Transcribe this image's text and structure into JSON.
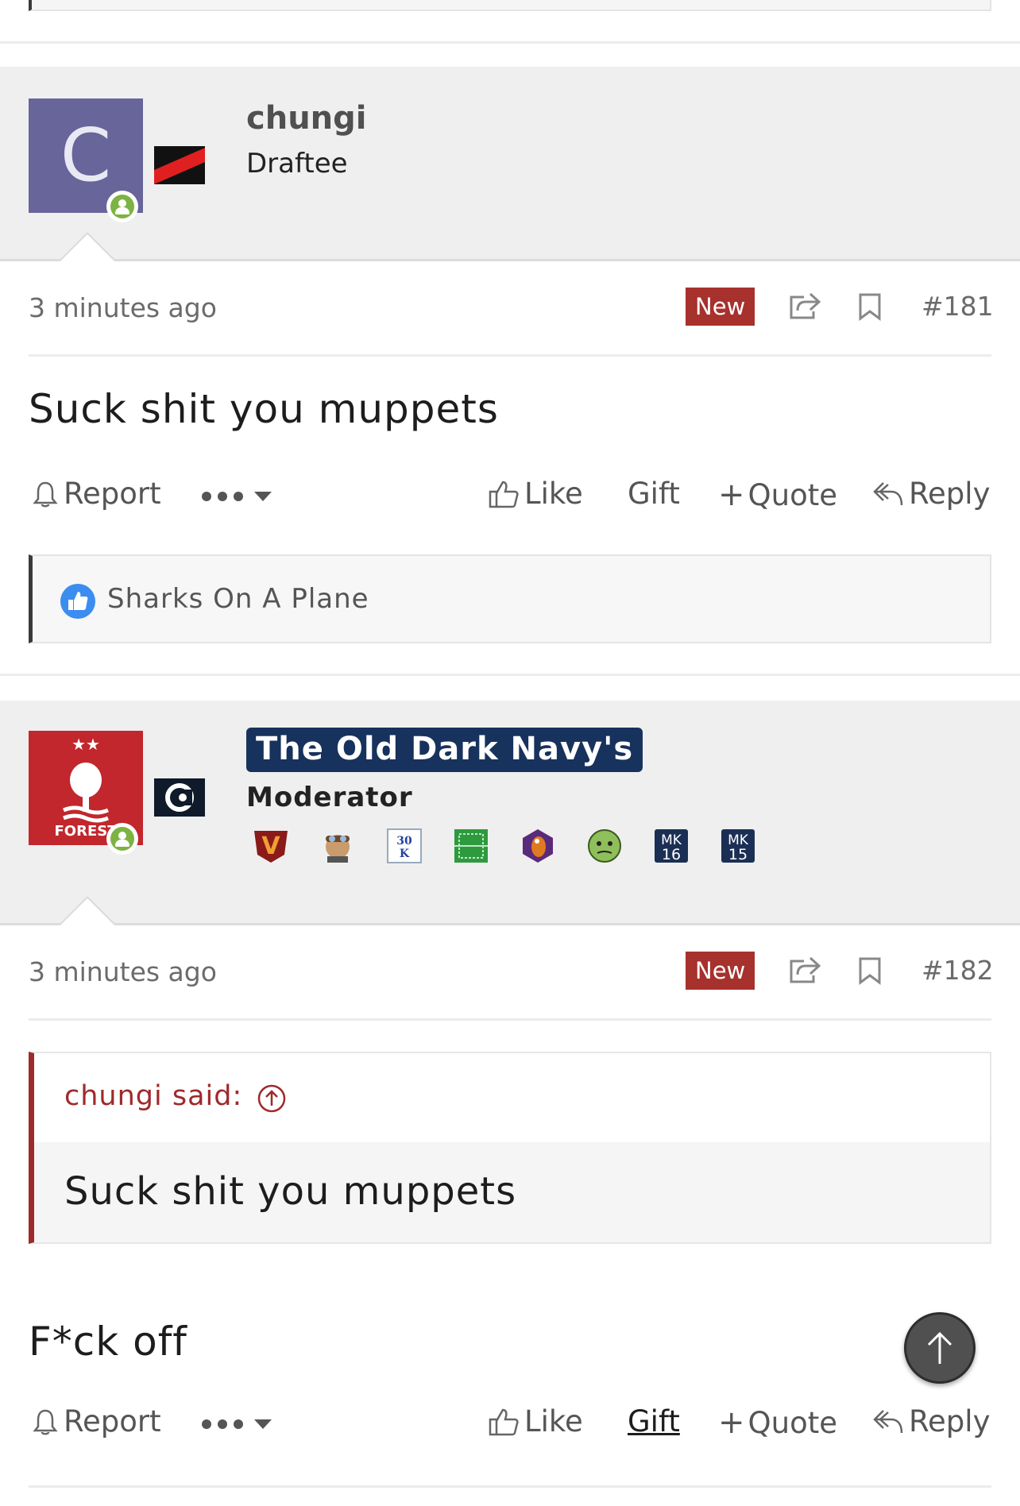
{
  "posts": [
    {
      "username": "chungi",
      "user_title": "Draftee",
      "avatar_letter": "C",
      "time": "3 minutes ago",
      "badge": "New",
      "post_number": "#181",
      "content": "Suck shit you muppets",
      "reactions_label": "Sharks On A Plane"
    },
    {
      "username": "The Old Dark Navy's",
      "user_title": "Moderator",
      "avatar_text": "FOREST",
      "time": "3 minutes ago",
      "badge": "New",
      "post_number": "#182",
      "quote_author": "chungi said:",
      "quote_content": "Suck shit you muppets",
      "content": "F*ck off",
      "award_labels": [
        "V",
        "30 K",
        "MK 16",
        "MK 15"
      ]
    }
  ],
  "actions": {
    "report": "Report",
    "like": "Like",
    "gift": "Gift",
    "quote": "Quote",
    "reply": "Reply"
  },
  "colors": {
    "avatar_c": "#67659a",
    "forest_red": "#c1272d",
    "new_badge": "#a7312d",
    "mod_banner": "#17325c",
    "online": "#7cb342",
    "quote_border": "#9e2a2b"
  }
}
